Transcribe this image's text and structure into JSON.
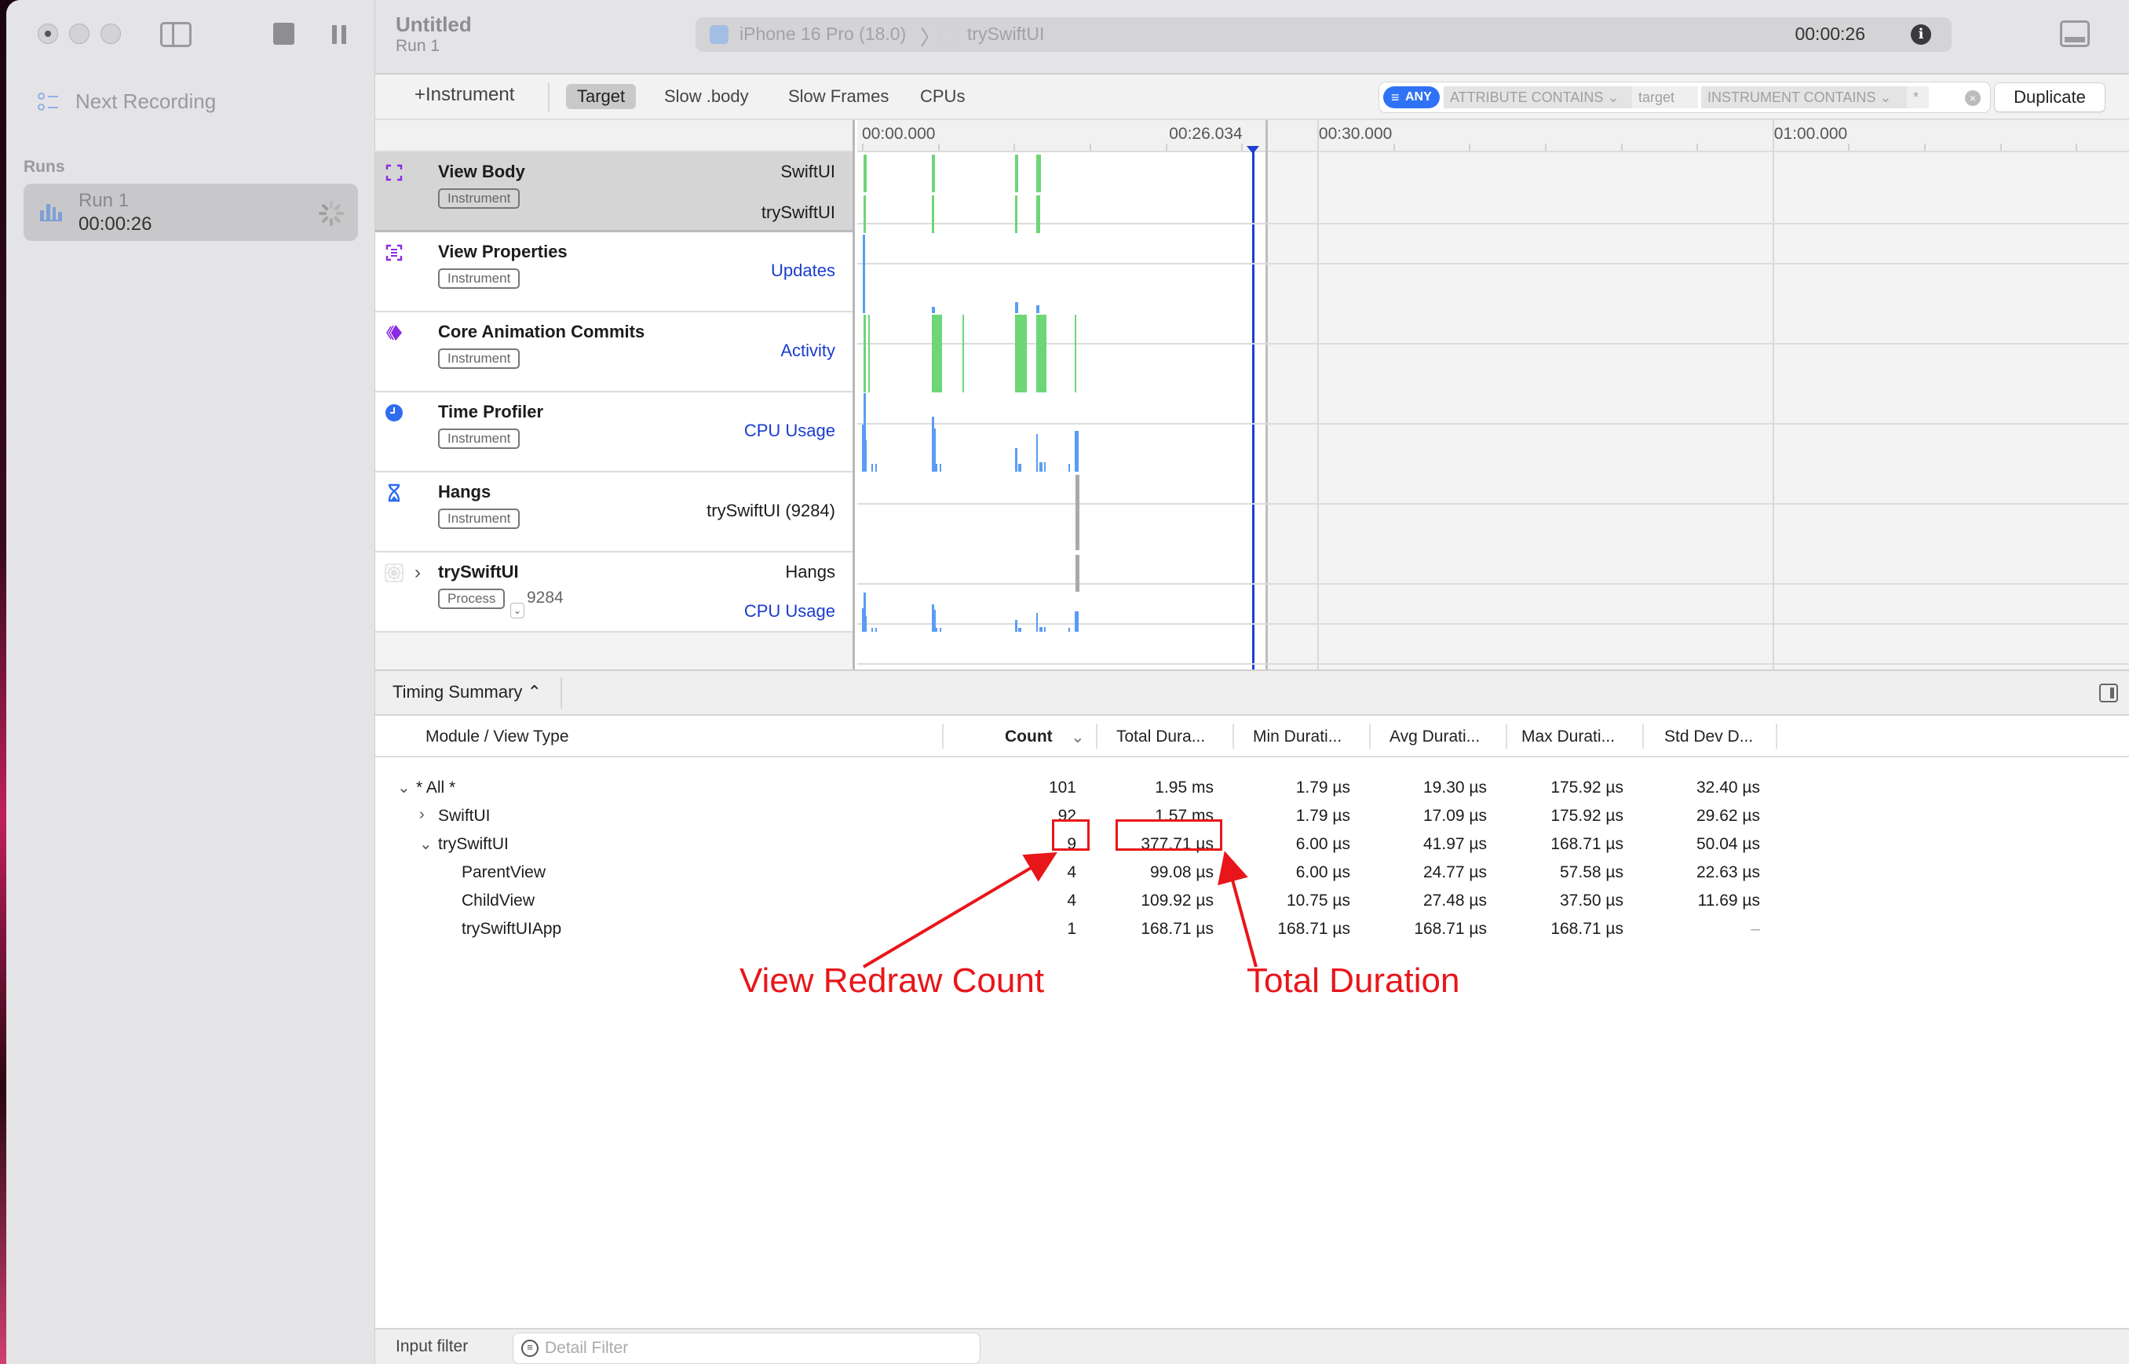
{
  "window": {
    "title": "Untitled",
    "subtitle": "Run 1"
  },
  "sidebar": {
    "next_recording": "Next Recording",
    "runs_label": "Runs",
    "runs": [
      {
        "name": "Run 1",
        "duration": "00:00:26",
        "status": "recording"
      }
    ]
  },
  "device_bar": {
    "device": "iPhone 16 Pro (18.0)",
    "separator": "〉",
    "target": "trySwiftUI",
    "elapsed": "00:00:26",
    "info_icon": "i"
  },
  "toolbar": {
    "add_instrument": "+Instrument",
    "tabs": [
      {
        "label": "Target",
        "active": true
      },
      {
        "label": "Slow .body",
        "active": false
      },
      {
        "label": "Slow Frames",
        "active": false
      },
      {
        "label": "CPUs",
        "active": false
      }
    ],
    "filter": {
      "mode": "ANY",
      "tokens": [
        {
          "label": "ATTRIBUTE CONTAINS ⌄",
          "value": "target"
        },
        {
          "label": "INSTRUMENT CONTAINS ⌄",
          "value": "*"
        }
      ],
      "clear": "×"
    },
    "duplicate_label": "Duplicate"
  },
  "timeline": {
    "labels": [
      {
        "text": "00:00.000",
        "time": 0
      },
      {
        "text": "00:26.034",
        "time": 26.034
      },
      {
        "text": "00:30.000",
        "time": 30
      },
      {
        "text": "01:00.000",
        "time": 60
      }
    ],
    "playhead_time": 26.034
  },
  "tracks": [
    {
      "title": "View Body",
      "tag": "Instrument",
      "lanes": [
        "SwiftUI",
        "trySwiftUI"
      ],
      "lane_style": "plain",
      "icon": "view-body-icon",
      "selected": true
    },
    {
      "title": "View Properties",
      "tag": "Instrument",
      "lanes": [
        "Updates"
      ],
      "lane_style": "link",
      "icon": "view-properties-icon"
    },
    {
      "title": "Core Animation Commits",
      "tag": "Instrument",
      "lanes": [
        "Activity"
      ],
      "lane_style": "link",
      "icon": "core-animation-icon"
    },
    {
      "title": "Time Profiler",
      "tag": "Instrument",
      "lanes": [
        "CPU Usage"
      ],
      "lane_style": "link",
      "icon": "time-profiler-icon"
    },
    {
      "title": "Hangs",
      "tag": "Instrument",
      "lanes": [
        "trySwiftUI (9284)"
      ],
      "lane_style": "plain",
      "icon": "hourglass-icon"
    },
    {
      "title": "trySwiftUI",
      "tag": "Process",
      "pid": "9284",
      "lanes": [
        "Hangs",
        "CPU Usage"
      ],
      "lane_style": "mixed",
      "icon": "app-process-icon"
    }
  ],
  "colors": {
    "accent": "#2f72f5",
    "link": "#1a3ccd",
    "activity_green": "#6dd676",
    "cpu_blue": "#5a9cf5",
    "hang_gray": "#a9a9a9",
    "playhead": "#1c3ed4",
    "annotation_red": "#e8161a"
  },
  "summary": {
    "view_selector": "Timing Summary ⌃",
    "columns": [
      "Module / View Type",
      "Count",
      "Total Dura...",
      "Min Durati...",
      "Avg Durati...",
      "Max Durati...",
      "Std Dev D..."
    ],
    "sort_indicator": "⌄",
    "rows": [
      {
        "name": "* All *",
        "level": 0,
        "expander": "open",
        "count": "101",
        "total": "1.95 ms",
        "min": "1.79 µs",
        "avg": "19.30 µs",
        "max": "175.92 µs",
        "std": "32.40 µs"
      },
      {
        "name": "SwiftUI",
        "level": 1,
        "expander": "closed",
        "count": "92",
        "total": "1.57 ms",
        "min": "1.79 µs",
        "avg": "17.09 µs",
        "max": "175.92 µs",
        "std": "29.62 µs"
      },
      {
        "name": "trySwiftUI",
        "level": 1,
        "expander": "open",
        "count": "9",
        "total": "377.71 µs",
        "min": "6.00 µs",
        "avg": "41.97 µs",
        "max": "168.71 µs",
        "std": "50.04 µs"
      },
      {
        "name": "ParentView",
        "level": 2,
        "expander": "none",
        "count": "4",
        "total": "99.08 µs",
        "min": "6.00 µs",
        "avg": "24.77 µs",
        "max": "57.58 µs",
        "std": "22.63 µs"
      },
      {
        "name": "ChildView",
        "level": 2,
        "expander": "none",
        "count": "4",
        "total": "109.92 µs",
        "min": "10.75 µs",
        "avg": "27.48 µs",
        "max": "37.50 µs",
        "std": "11.69 µs"
      },
      {
        "name": "trySwiftUIApp",
        "level": 2,
        "expander": "none",
        "count": "1",
        "total": "168.71 µs",
        "min": "168.71 µs",
        "avg": "168.71 µs",
        "max": "168.71 µs",
        "std": "–"
      }
    ]
  },
  "annotations": {
    "redraw_count": "View Redraw Count",
    "total_duration": "Total Duration"
  },
  "bottom": {
    "input_filter_label": "Input filter",
    "detail_filter_placeholder": "Detail Filter"
  }
}
